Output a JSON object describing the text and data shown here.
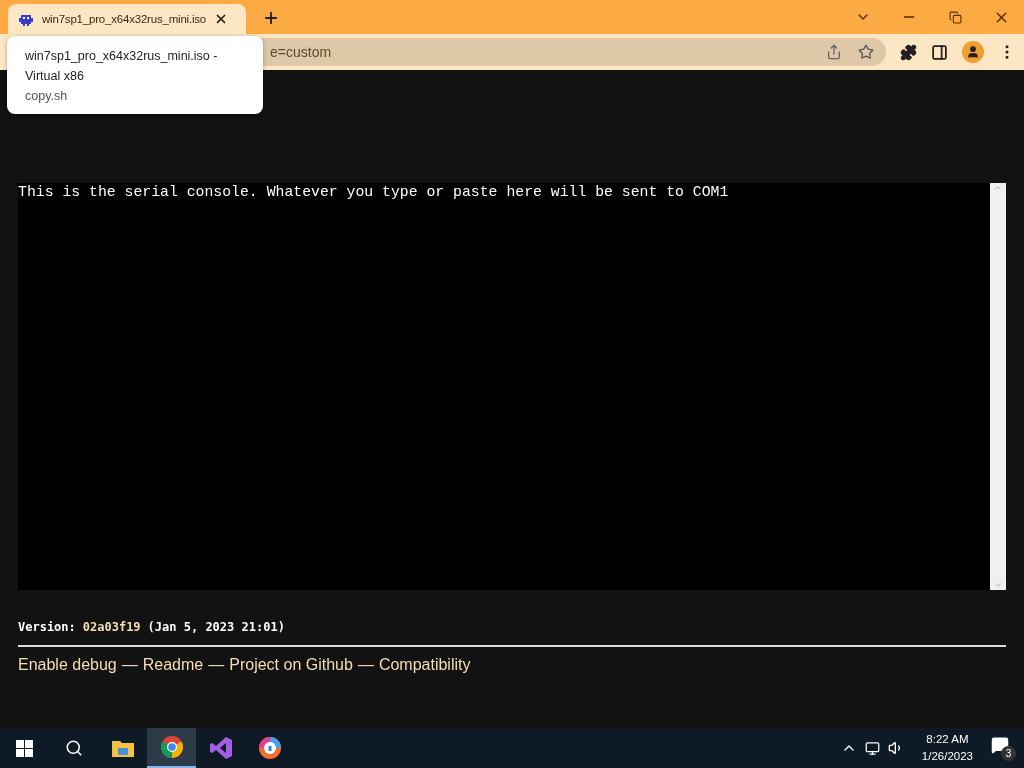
{
  "browser": {
    "tab": {
      "title": "win7sp1_pro_x64x32rus_mini.iso",
      "selected": true
    },
    "tooltip": {
      "title": "win7sp1_pro_x64x32rus_mini.iso - Virtual x86",
      "source": "copy.sh"
    },
    "address": "e=custom"
  },
  "console": {
    "text": "This is the serial console. Whatever you type or paste here will be sent to COM1"
  },
  "version": {
    "label": "Version:",
    "hash": "02a03f19",
    "date": "(Jan 5, 2023 21:01)"
  },
  "links": [
    {
      "label": "Enable debug"
    },
    {
      "label": "Readme"
    },
    {
      "label": "Project on Github"
    },
    {
      "label": "Compatibility"
    }
  ],
  "separator": "—",
  "taskbar": {
    "apps": [
      {
        "kind": "explorer",
        "active": false
      },
      {
        "kind": "chrome",
        "active": true
      },
      {
        "kind": "studio",
        "active": false
      },
      {
        "kind": "shield",
        "active": false
      }
    ],
    "time": "8:22 AM",
    "date": "1/26/2023",
    "notifications": "3"
  }
}
